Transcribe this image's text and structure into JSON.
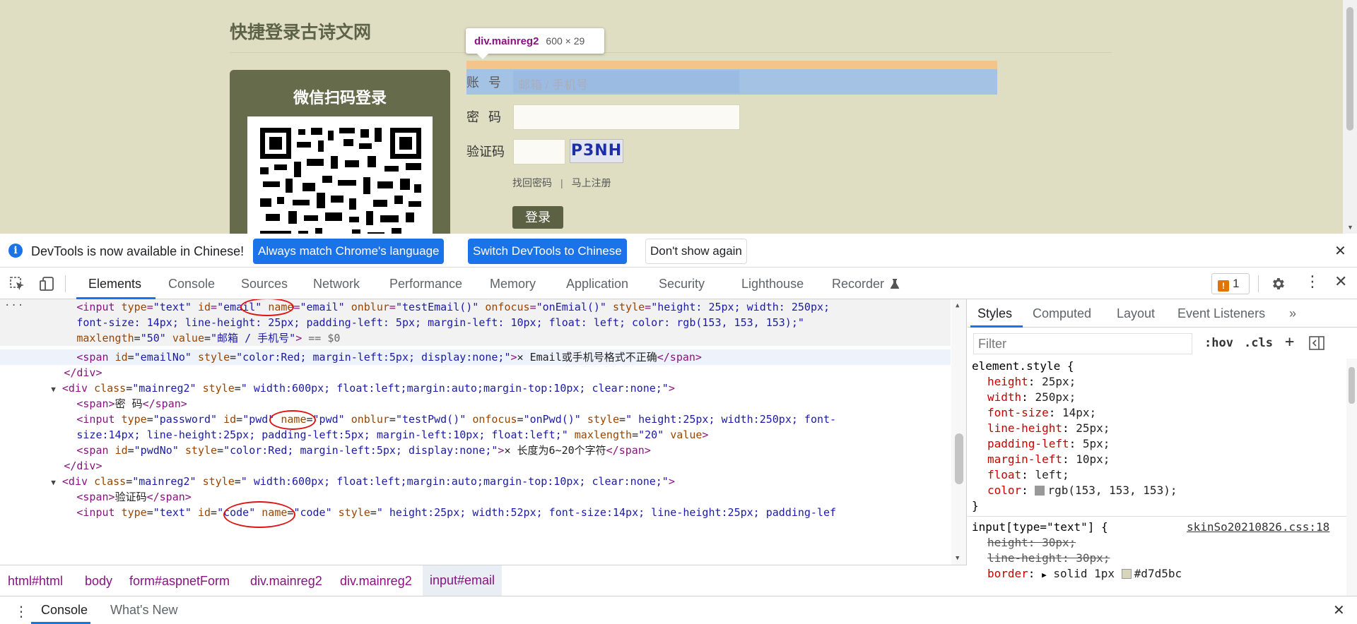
{
  "page": {
    "site_title": "快捷登录古诗文网",
    "wechat_title": "微信扫码登录",
    "tooltip": {
      "name": "div.mainreg2",
      "size": "600 × 29"
    },
    "account_label": "账 号",
    "account_placeholder": "邮箱 / 手机号",
    "password_label": "密 码",
    "captcha_label": "验证码",
    "captcha_text": "P3NH",
    "link_forgot": "找回密码",
    "link_sep": "|",
    "link_register": "马上注册",
    "login_button": "登录"
  },
  "infobar": {
    "icon": "info-icon",
    "message": "DevTools is now available in Chinese!",
    "btn_match": "Always match Chrome's language",
    "btn_switch": "Switch DevTools to Chinese",
    "btn_dont_show": "Don't show again",
    "close": "✕"
  },
  "tabs": [
    "Elements",
    "Console",
    "Sources",
    "Network",
    "Performance",
    "Memory",
    "Application",
    "Security",
    "Lighthouse",
    "Recorder"
  ],
  "issues_count": "1",
  "elements": {
    "line1": {
      "a1": "<",
      "tag": "input",
      "t1": " ",
      "attr1": "type",
      "eq1": "=",
      "v1": "\"text\"",
      "attr2": "id",
      "v2": "\"email\"",
      "attr3": "name",
      "v3": "\"email\"",
      "attr4": "onblur",
      "v4": "\"testEmail()\"",
      "attr5": "onfocus",
      "v5": "\"onEmial()\"",
      "attr6": "style",
      "v6": "\"height: 25px; width: 250px;"
    },
    "line2": "font-size: 14px; line-height: 25px; padding-left: 5px; margin-left: 10px; float: left; color: rgb(153, 153, 153);\"",
    "line3": {
      "attr1": "maxlength",
      "v1": "\"50\"",
      "attr2": "value",
      "v2": "\"邮箱 / 手机号\"",
      "end": ">",
      "cm": " == $0"
    },
    "line4": {
      "attr1": "id",
      "v1": "\"emailNo\"",
      "attr2": "style",
      "v2": "\"color:Red; margin-left:5px; display:none;\"",
      "text": "✕ Email或手机号格式不正确"
    },
    "line5": "</div>",
    "line6": {
      "attr1": "class",
      "v1": "\"mainreg2\"",
      "attr2": "style",
      "v2": "\" width:600px; float:left;margin:auto;margin-top:10px; clear:none;\""
    },
    "line7": {
      "text": "密 码"
    },
    "line8": {
      "attr1": "type",
      "v1": "\"password\"",
      "attr2": "id",
      "v2": "\"pwd\"",
      "attr3": "name",
      "v3": "\"pwd\"",
      "attr4": "onblur",
      "v4": "\"testPwd()\"",
      "attr5": "onfocus",
      "v5": "\"onPwd()\"",
      "attr6": "style",
      "v6": "\" height:25px; width:250px; font-"
    },
    "line9": {
      "v1": "size:14px; line-height:25px; padding-left:5px; margin-left:10px; float:left;\"",
      "attr1": "maxlength",
      "v2": "\"20\"",
      "attr2": "value"
    },
    "line10": {
      "attr1": "id",
      "v1": "\"pwdNo\"",
      "attr2": "style",
      "v2": "\"color:Red; margin-left:5px; display:none;\"",
      "text": "✕ 长度为6~20个字符"
    },
    "line11": "</div>",
    "line12": {
      "attr1": "class",
      "v1": "\"mainreg2\"",
      "attr2": "style",
      "v2": "\" width:600px; float:left;margin:auto;margin-top:10px; clear:none;\""
    },
    "line13": {
      "text": "验证码"
    },
    "line14": {
      "attr1": "type",
      "v1": "\"text\"",
      "attr2": "id",
      "v2": "\"code\"",
      "attr3": "name",
      "v3": "\"code\"",
      "attr4": "style",
      "v4": "\" height:25px; width:52px; font-size:14px; line-height:25px; padding-lef"
    }
  },
  "breadcrumbs": [
    "html#html",
    "body",
    "form#aspnetForm",
    "div.mainreg2",
    "div.mainreg2",
    "input#email"
  ],
  "styles": {
    "tabs": [
      "Styles",
      "Computed",
      "Layout",
      "Event Listeners",
      "»"
    ],
    "filter_placeholder": "Filter",
    "hov": ":hov",
    "cls": ".cls",
    "plus": "+",
    "element_style": "element.style {",
    "props": [
      {
        "n": "height",
        "v": "25px;"
      },
      {
        "n": "width",
        "v": "250px;"
      },
      {
        "n": "font-size",
        "v": "14px;"
      },
      {
        "n": "line-height",
        "v": "25px;"
      },
      {
        "n": "padding-left",
        "v": "5px;"
      },
      {
        "n": "margin-left",
        "v": "10px;"
      },
      {
        "n": "float",
        "v": "left;"
      },
      {
        "n": "color",
        "v": "rgb(153, 153, 153);"
      }
    ],
    "close_brace": "}",
    "rule2_selector": "input[type=\"text\"] {",
    "rule2_source": "skinSo20210826.css:18",
    "rule2_props": [
      {
        "n": "height",
        "v": "30px;"
      },
      {
        "n": "line-height",
        "v": "30px;"
      },
      {
        "n": "border",
        "v": "solid 1px",
        "color": "#d7d5bc"
      }
    ],
    "swatch_color": "#999999"
  },
  "drawer": {
    "tabs": [
      "Console",
      "What's New"
    ],
    "close": "✕"
  },
  "colors": {
    "page_bg": "#e0dec2",
    "panel_green": "#666b4c",
    "accent": "#1a73e8",
    "highlight_margin": "#f4c58b",
    "highlight_box": "#a4c2e4"
  }
}
